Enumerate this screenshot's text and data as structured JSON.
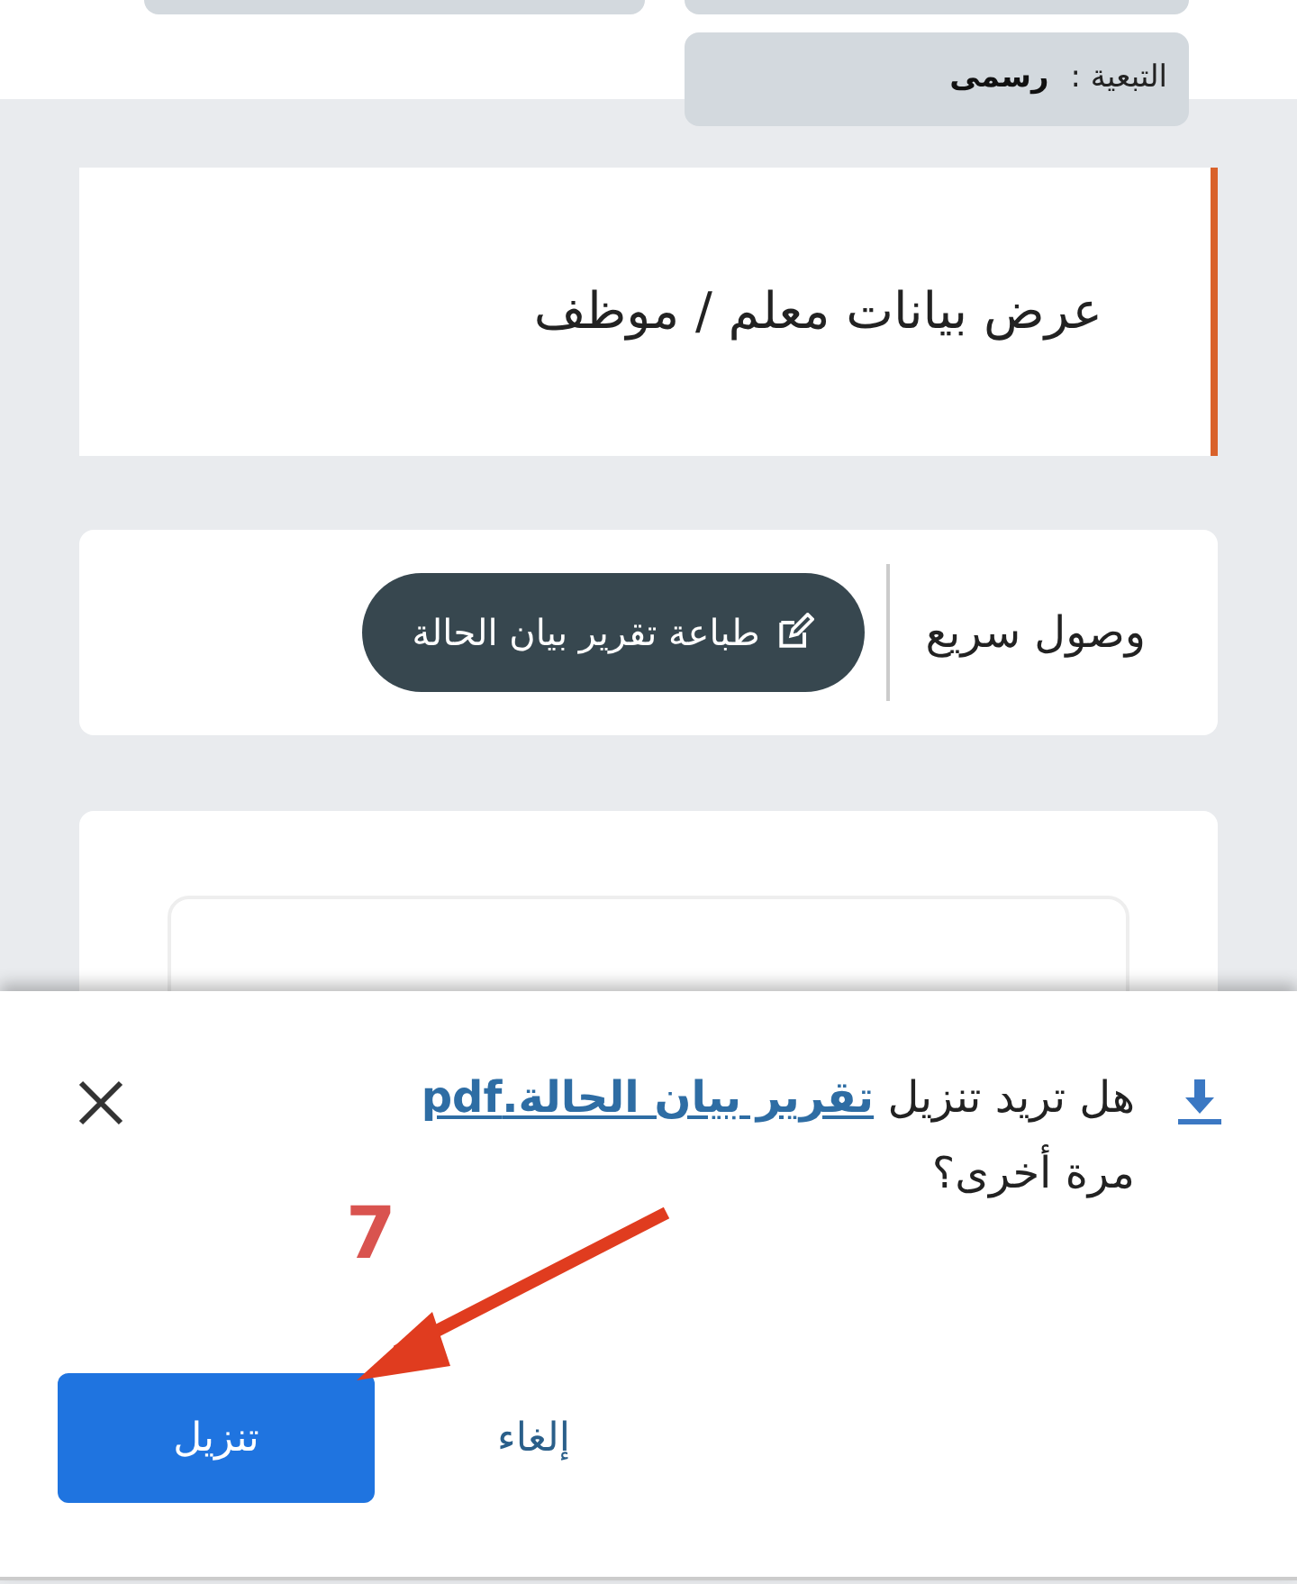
{
  "info_field": {
    "label": "التبعية :",
    "value": "رسمى"
  },
  "page_title": "عرض بيانات معلم / موظف",
  "quick_access": {
    "label": "وصول سريع",
    "buttons": [
      "طباعة تقرير بيان الحالة"
    ]
  },
  "download_dialog": {
    "message_before": "هل تريد تنزيل",
    "file_link": "تقرير بيان الحالة.pdf",
    "message_after": "مرة أخرى؟",
    "buttons": [
      {
        "label": "إلغاء",
        "kind": "text"
      },
      {
        "label": "تنزيل",
        "kind": "primary"
      }
    ]
  },
  "annotation": {
    "label": "7"
  }
}
